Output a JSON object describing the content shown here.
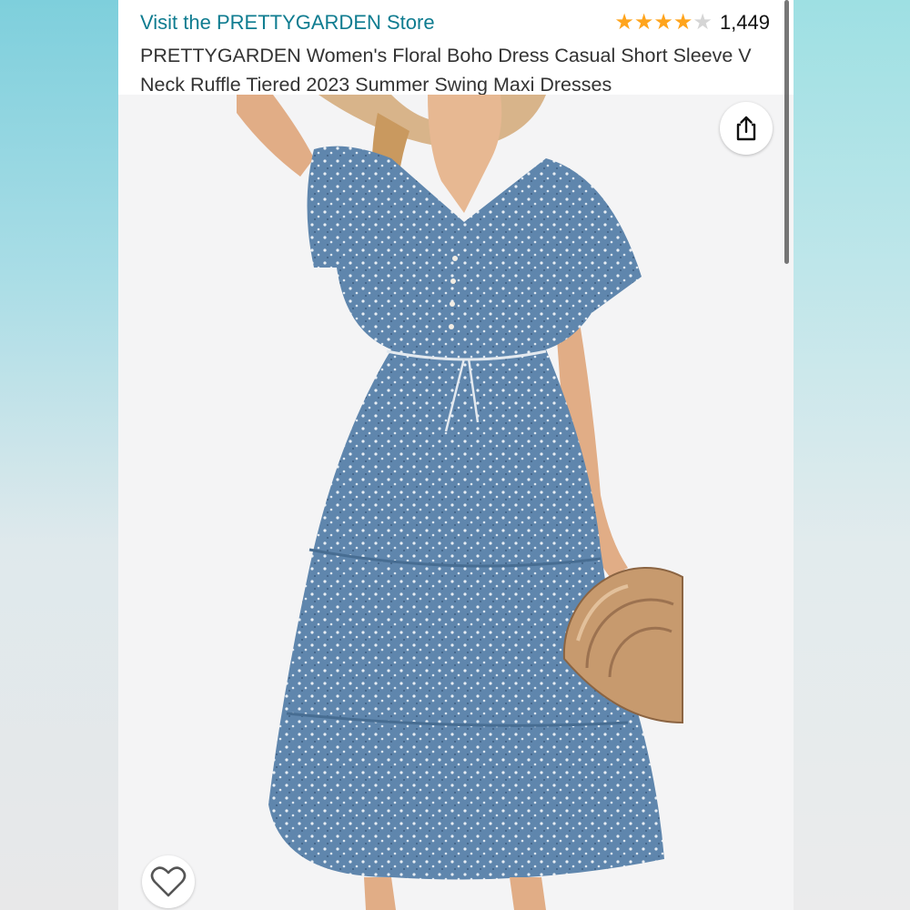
{
  "header": {
    "store_link": "Visit the PRETTYGARDEN Store",
    "rating_count": "1,449",
    "rating_value": 4,
    "rating_max": 5,
    "title": "PRETTYGARDEN Women's Floral Boho Dress Casual Short Sleeve V Neck Ruffle Tiered 2023 Summer Swing Maxi Dresses"
  },
  "icons": {
    "share": "share-icon",
    "favorite": "heart-icon",
    "star": "star-icon"
  },
  "colors": {
    "link": "#0f7c90",
    "star": "#ffa41c",
    "dress": "#5f86ad",
    "bag": "#c79a6e"
  }
}
